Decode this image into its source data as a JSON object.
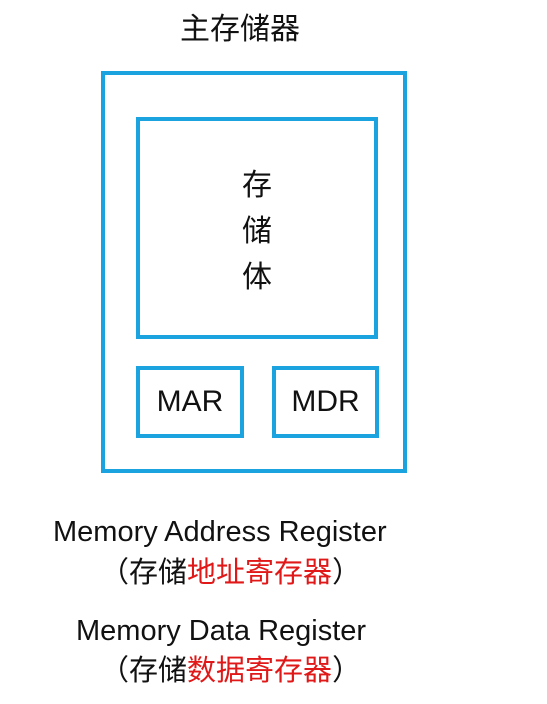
{
  "title": "主存储器",
  "memory_body": {
    "chars": [
      "存",
      "储",
      "体"
    ]
  },
  "registers": {
    "mar": "MAR",
    "mdr": "MDR"
  },
  "captions": [
    {
      "english": "Memory Address Register",
      "open": "（",
      "prefix": "存储",
      "highlight": "地址",
      "suffix": "寄存器",
      "close": "）"
    },
    {
      "english": "Memory Data Register",
      "open": "（",
      "prefix": "存储",
      "highlight": "数据",
      "suffix": "寄存器",
      "close": "）"
    }
  ],
  "colors": {
    "box_border": "#1aa3de",
    "highlight": "#e01818",
    "text": "#111111"
  }
}
